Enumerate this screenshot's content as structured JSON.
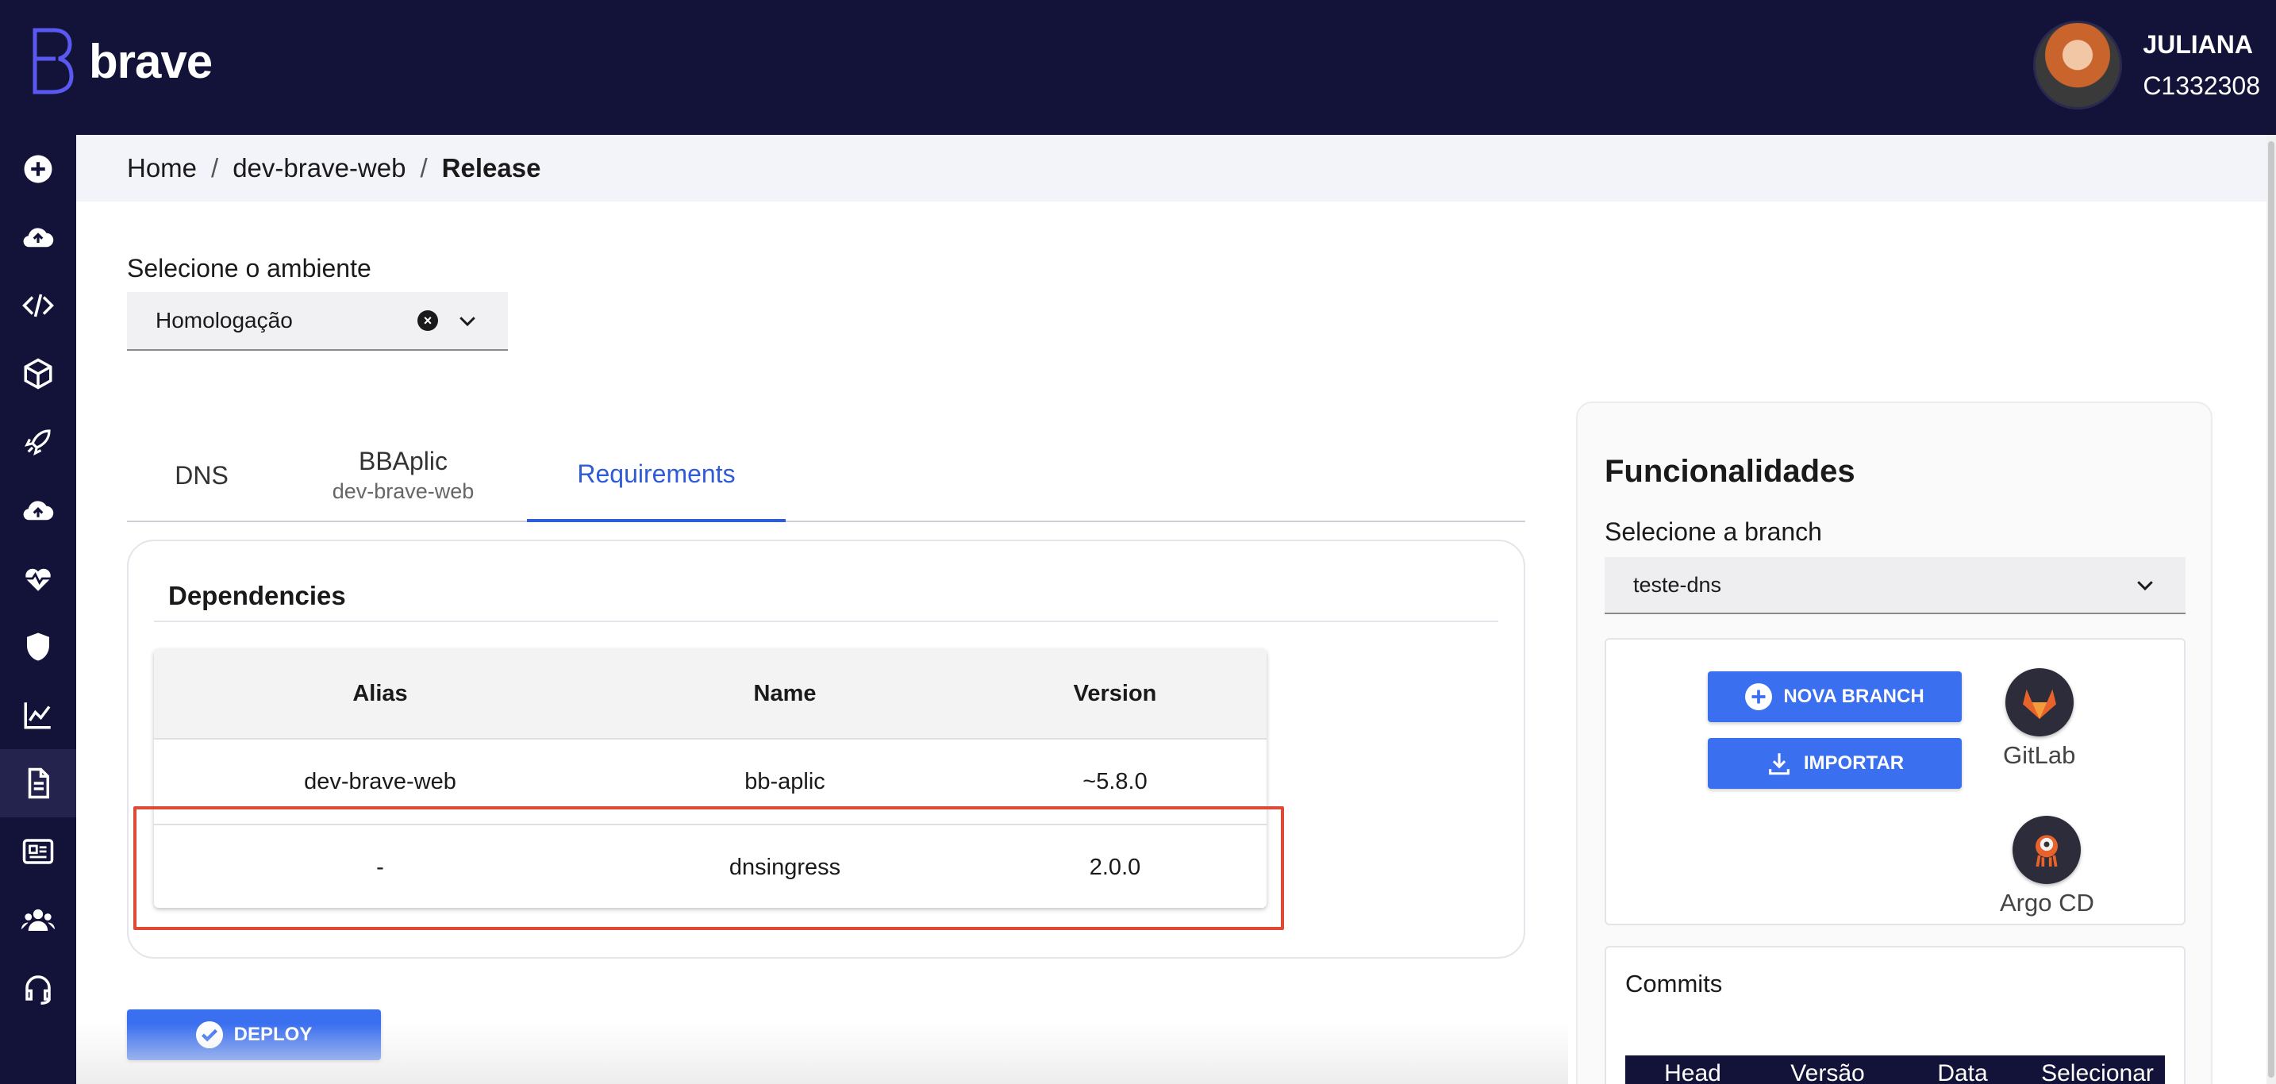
{
  "app": {
    "logo_text": "brave"
  },
  "user": {
    "name": "JULIANA",
    "id": "C1332308"
  },
  "breadcrumb": [
    "Home",
    "dev-brave-web",
    "Release"
  ],
  "sidebar": {
    "items": [
      {
        "icon": "plus-circle-icon"
      },
      {
        "icon": "cloud-sync-icon"
      },
      {
        "icon": "code-icon"
      },
      {
        "icon": "package-icon"
      },
      {
        "icon": "rocket-icon"
      },
      {
        "icon": "cloud-upload-icon"
      },
      {
        "icon": "heartbeat-icon"
      },
      {
        "icon": "shield-icon"
      },
      {
        "icon": "chart-line-icon"
      },
      {
        "icon": "document-icon",
        "active": true
      },
      {
        "icon": "newspaper-icon"
      },
      {
        "icon": "users-icon"
      },
      {
        "icon": "headset-icon"
      }
    ]
  },
  "environment": {
    "label": "Selecione o ambiente",
    "value": "Homologação"
  },
  "tabs": [
    {
      "label": "DNS"
    },
    {
      "label": "BBAplic",
      "sub": "dev-brave-web"
    },
    {
      "label": "Requirements",
      "active": true
    }
  ],
  "dependencies": {
    "title": "Dependencies",
    "columns": [
      "Alias",
      "Name",
      "Version"
    ],
    "rows": [
      [
        "dev-brave-web",
        "bb-aplic",
        "~5.8.0"
      ],
      [
        "-",
        "dnsingress",
        "2.0.0"
      ]
    ]
  },
  "deploy_button": "DEPLOY",
  "panel": {
    "title": "Funcionalidades",
    "branch_label": "Selecione a branch",
    "branch_value": "teste-dns",
    "nova_branch": "NOVA BRANCH",
    "importar": "IMPORTAR",
    "gitlab": "GitLab",
    "argocd": "Argo CD",
    "commits_title": "Commits",
    "commits_columns": [
      "Head",
      "Versão",
      "Data",
      "Selecionar"
    ]
  },
  "colors": {
    "navy": "#13133a",
    "accent": "#3a6ff0",
    "tab_active": "#2f5bd8",
    "highlight": "#e04a33"
  }
}
